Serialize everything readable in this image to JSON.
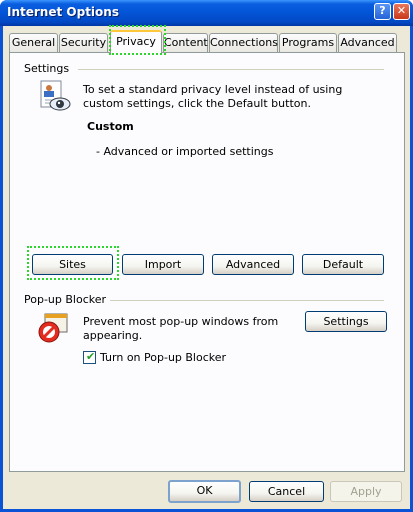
{
  "window": {
    "title": "Internet Options",
    "help_glyph": "?",
    "close_glyph": "✕"
  },
  "tabs": [
    {
      "label": "General"
    },
    {
      "label": "Security"
    },
    {
      "label": "Privacy"
    },
    {
      "label": "Content"
    },
    {
      "label": "Connections"
    },
    {
      "label": "Programs"
    },
    {
      "label": "Advanced"
    }
  ],
  "active_tab": "Privacy",
  "settings": {
    "group_label": "Settings",
    "description": "To set a standard privacy level instead of using custom settings, click the Default button.",
    "level_title": "Custom",
    "level_detail": "- Advanced or imported settings",
    "icon": "privacy-settings-icon",
    "buttons": {
      "sites": "Sites",
      "import": "Import",
      "advanced": "Advanced",
      "default": "Default"
    }
  },
  "popup_blocker": {
    "group_label": "Pop-up Blocker",
    "description": "Prevent most pop-up windows from appearing.",
    "settings_button": "Settings",
    "checkbox_label": "Turn on Pop-up Blocker",
    "checkbox_checked": true,
    "icon": "popup-blocker-icon"
  },
  "footer": {
    "ok": "OK",
    "cancel": "Cancel",
    "apply": "Apply",
    "apply_enabled": false
  },
  "colors": {
    "title_bar": "#0a52d6",
    "dialog_bg": "#ece9d8",
    "focus_ring": "#2cd62c",
    "tab_highlight": "#ffc83c"
  }
}
